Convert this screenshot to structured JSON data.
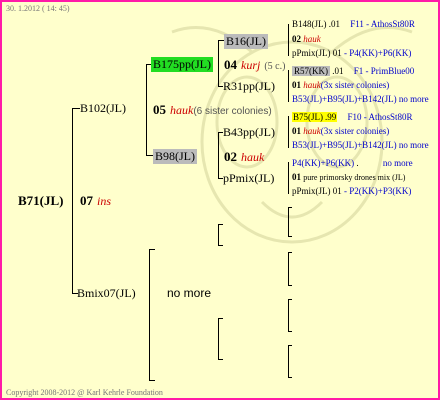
{
  "header": "30. 1.2012 ( 14: 45)",
  "footer": "Copyright 2008-2012 @ Karl Kehrle Foundation",
  "root": {
    "name": "B71(JL)",
    "gen": "07",
    "breeder": "ins"
  },
  "gen1": {
    "mother": {
      "name": "B102(JL)",
      "gen": "05",
      "breeder": "hauk",
      "note": "(6 sister colonies)"
    },
    "father": {
      "name": "Bmix07(JL)",
      "no_more": "no more"
    }
  },
  "gen2": {
    "mm": {
      "name": "B175pp(JL)",
      "gen": "04",
      "breeder": "kurj",
      "note": "(5 c.)"
    },
    "mf": {
      "name": "B98(JL)",
      "gen": "02",
      "breeder": "hauk"
    }
  },
  "gen3": {
    "mmm": {
      "name": "B16(JL)"
    },
    "mmf": {
      "name": "R31pp(JL)"
    },
    "mfm": {
      "name": "B43pp(JL)"
    },
    "mff": {
      "name": "pPmix(JL)"
    }
  },
  "gen4": {
    "b16": {
      "l1_name": "B148(JL)",
      "l1_num": ".01",
      "l1_info": "F11 - AthosSt80R",
      "l2_gen": "02",
      "l2_breeder": "hauk",
      "l3_name": "pPmix(JL)",
      "l3_num": "01",
      "l3_info": "- P4(KK)+P6(KK)"
    },
    "r31": {
      "l1_name": "R57(KK)",
      "l1_num": ".01",
      "l1_info": "F1 - PrimBlue00",
      "l2_gen": "01",
      "l2_breeder": "hauk",
      "l2_note": "(3x sister colonies)",
      "l3_text": "B53(JL)+B95(JL)+B142(JL)",
      "l3_more": "no more"
    },
    "b43": {
      "l1_name": "B75(JL)",
      "l1_num": ".99",
      "l1_info": "F10 - AthosSt80R",
      "l2_gen": "01",
      "l2_breeder": "hauk",
      "l2_note": "(3x sister colonies)",
      "l3_text": "B53(JL)+B95(JL)+B142(JL)",
      "l3_more": "no more"
    },
    "ppmix": {
      "l1_text": "P4(KK)+P6(KK)",
      "l1_dot": ".",
      "l1_more": "no more",
      "l2_gen": "01",
      "l2_note": "pure primorsky drones mix (JL)",
      "l3_name": "pPmix(JL)",
      "l3_num": "01",
      "l3_info": "- P2(KK)+P3(KK)"
    }
  },
  "colors": {
    "border": "#ff1aa8",
    "background": "#ffffcc",
    "highlight_green": "#22dd22",
    "highlight_gray": "#bbbbbb",
    "highlight_yellow": "#ffff00",
    "breeder_red": "#cc0000",
    "note_blue": "#0000cc"
  }
}
